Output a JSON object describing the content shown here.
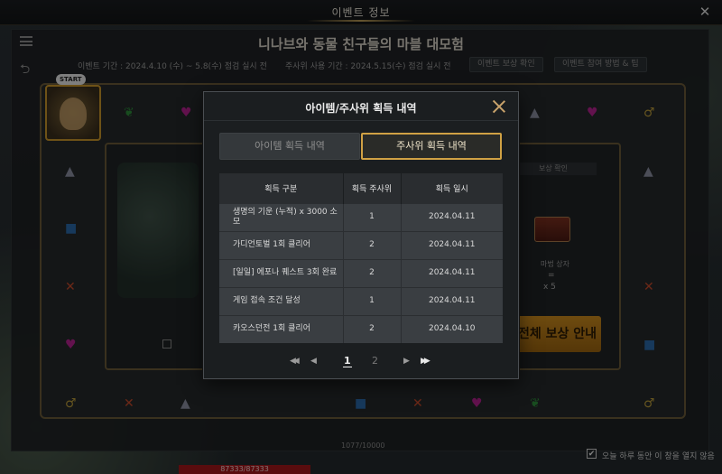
{
  "window": {
    "title": "이벤트 정보",
    "close_icon": "close-icon"
  },
  "event": {
    "title": "니나브와 동물 친구들의 마블 대모험",
    "period": "이벤트 기간 : 2024.4.10 (수) ~ 5.8(수) 점검 실시 전",
    "usage_period": "주사위 사용 기간 : 2024.5.15(수) 점검 실시 전",
    "button_a": "이벤트 보상 확인",
    "button_b": "이벤트 참여 방법 & 팁",
    "start_badge": "START",
    "reward_chip": "보상 확인",
    "reward_text": "마법 상자",
    "reward_eq": "=",
    "reward_count": "x 5",
    "reward_button": "전체 보상 안내",
    "progress": "1077/10000",
    "hp": "87333/87333"
  },
  "footer": {
    "dont_show_today": "오늘 하루 동안 이 창을 열지 않음",
    "checked": true
  },
  "modal": {
    "title": "아이템/주사위 획득 내역",
    "tabs": [
      "아이템 획득 내역",
      "주사위 획득 내역"
    ],
    "active_tab": 1,
    "columns": [
      "획득 구분",
      "획득 주사위",
      "획득 일시"
    ],
    "rows": [
      {
        "category": "생명의 기운 (누적) x 3000 소모",
        "dice": "1",
        "date": "2024.04.11"
      },
      {
        "category": "가디언토벌 1회 클리어",
        "dice": "2",
        "date": "2024.04.11"
      },
      {
        "category": "[일일] 에포나 퀘스트 3회 완료",
        "dice": "2",
        "date": "2024.04.11"
      },
      {
        "category": "게임 접속 조건 달성",
        "dice": "1",
        "date": "2024.04.11"
      },
      {
        "category": "카오스던전 1회 클리어",
        "dice": "2",
        "date": "2024.04.10"
      }
    ],
    "pagination": {
      "first": "◀◀",
      "prev": "◀",
      "pages": [
        "1",
        "2"
      ],
      "current": "1",
      "next": "▶",
      "last": "▶▶"
    }
  },
  "colors": {
    "accent_gold": "#d0a144",
    "board_border": "#6b5a38",
    "heart": "#b5228f",
    "leaf": "#2c8a3a",
    "cross": "#c44a2a"
  },
  "board_icons": {
    "heart": "heart-icon",
    "leaf": "leaf-icon",
    "cross": "cross-icon",
    "triangle": "triangle-icon",
    "fruit": "fruit-icon",
    "cube": "cube-icon"
  }
}
